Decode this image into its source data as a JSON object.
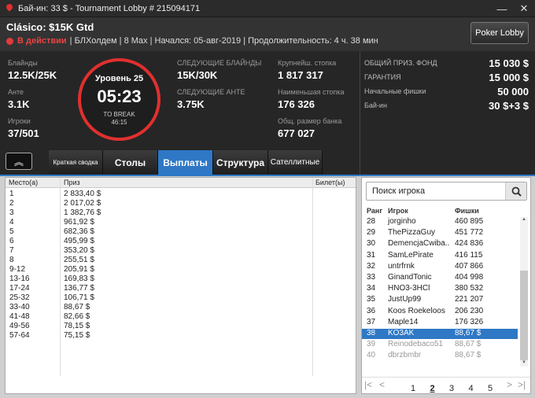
{
  "window": {
    "title": "Бай-ин: 33 $ - Tournament Lobby # 215094171",
    "minimize_glyph": "—",
    "close_glyph": "✕"
  },
  "header": {
    "tournament_name": "Clásico: $15K Gtd",
    "status": "В действии",
    "details": "| БЛХолдем | 8 Max | Начался: 05-авг-2019 | Продолжительность: 4 ч. 38 мин",
    "lobby_button": "Poker Lobby"
  },
  "stats": {
    "blinds_label": "Блайнды",
    "blinds": "12.5K/25K",
    "ante_label": "Анте",
    "ante": "3.1K",
    "players_label": "Игроки",
    "players": "37/501",
    "level": "Уровень 25",
    "clock": "05:23",
    "to_break": "TO BREAK",
    "break_time": "46:15",
    "next_blinds_label": "СЛЕДУЮЩИЕ БЛАЙНДЫ",
    "next_blinds": "15K/30K",
    "next_ante_label": "СЛЕДУЮЩИЕ АНТЕ",
    "next_ante": "3.75K",
    "largest_stack_label": "Крупнейш. стопка",
    "largest_stack": "1 817 317",
    "smallest_stack_label": "Наименьшая стопка",
    "smallest_stack": "176 326",
    "total_bank_label": "Общ. размер банка",
    "total_bank": "677 027"
  },
  "prize": {
    "pool_label": "ОБЩИЙ ПРИЗ. ФОНД",
    "pool": "15 030 $",
    "guarantee_label": "ГАРАНТИЯ",
    "guarantee": "15 000 $",
    "chips_label": "Начальные фишки",
    "chips": "50 000",
    "buyin_label": "Бай-ин",
    "buyin": "30 $+3 $"
  },
  "tabs": [
    "Краткая сводка",
    "Столы",
    "Выплаты",
    "Структура",
    "Сателлитные"
  ],
  "collapse_glyph": "︽",
  "payouts": {
    "headers": {
      "place": "Место(а)",
      "prize": "Приз",
      "ticket": "Билет(ы)"
    },
    "rows": [
      [
        "1",
        "2 833,40 $"
      ],
      [
        "2",
        "2 017,02 $"
      ],
      [
        "3",
        "1 382,76 $"
      ],
      [
        "4",
        "961,92 $"
      ],
      [
        "5",
        "682,36 $"
      ],
      [
        "6",
        "495,99 $"
      ],
      [
        "7",
        "353,20 $"
      ],
      [
        "8",
        "255,51 $"
      ],
      [
        "9-12",
        "205,91 $"
      ],
      [
        "13-16",
        "169,83 $"
      ],
      [
        "17-24",
        "136,77 $"
      ],
      [
        "25-32",
        "106,71 $"
      ],
      [
        "33-40",
        "88,67 $"
      ],
      [
        "41-48",
        "82,66 $"
      ],
      [
        "49-56",
        "78,15 $"
      ],
      [
        "57-64",
        "75,15 $"
      ]
    ]
  },
  "players_panel": {
    "search_placeholder": "Поиск игрока",
    "headers": {
      "rank": "Ранг",
      "player": "Игрок",
      "chips": "Фишки"
    },
    "rows": [
      [
        "28",
        "jorginho",
        "460 895"
      ],
      [
        "29",
        "ThePizzaGuy",
        "451 772"
      ],
      [
        "30",
        "DemencjaCwiba..",
        "424 836"
      ],
      [
        "31",
        "SamLePirate",
        "416 115"
      ],
      [
        "32",
        "untrfrnk",
        "407 866"
      ],
      [
        "33",
        "GinandTonic",
        "404 998"
      ],
      [
        "34",
        "HNO3-3HCl",
        "380 532"
      ],
      [
        "35",
        "JustUp99",
        "221 207"
      ],
      [
        "36",
        "Koos Roekeloos",
        "206 230"
      ],
      [
        "37",
        "Maple14",
        "176 326"
      ],
      [
        "38",
        "KO3AK",
        "88,67 $"
      ],
      [
        "39",
        "Reinodebaco51",
        "88,67 $"
      ],
      [
        "40",
        "dbrzbmbr",
        "88,67 $"
      ]
    ],
    "selected_index": 10,
    "pages": [
      "1",
      "2",
      "3",
      "4",
      "5"
    ],
    "current_page": "2",
    "nav": {
      "first": "|<",
      "prev": "<",
      "next": ">",
      "last": ">|"
    }
  }
}
